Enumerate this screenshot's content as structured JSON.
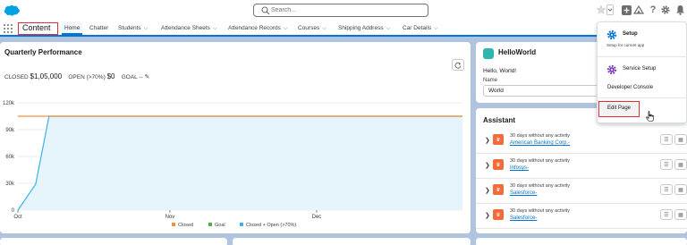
{
  "header": {
    "search": {
      "placeholder": "Search..."
    }
  },
  "nav": {
    "app_name": "Content",
    "tabs": [
      {
        "label": "Home",
        "has_chevron": false,
        "active": true
      },
      {
        "label": "Chatter",
        "has_chevron": false,
        "active": false
      },
      {
        "label": "Students",
        "has_chevron": true,
        "active": false
      },
      {
        "label": "Attendance Sheets",
        "has_chevron": true,
        "active": false
      },
      {
        "label": "Attendance Records",
        "has_chevron": true,
        "active": false
      },
      {
        "label": "Courses",
        "has_chevron": true,
        "active": false
      },
      {
        "label": "Shipping Address",
        "has_chevron": true,
        "active": false
      },
      {
        "label": "Car Details",
        "has_chevron": true,
        "active": false
      }
    ]
  },
  "quarterly": {
    "title": "Quarterly Performance",
    "closed_label": "CLOSED",
    "closed_value": "$1,05,000",
    "open_label": "OPEN (>70%)",
    "open_value": "$0",
    "goal_label": "GOAL",
    "goal_value": "--"
  },
  "chart_data": {
    "type": "area",
    "x_ticks": [
      "Oct",
      "Nov",
      "Dec"
    ],
    "y_ticks": [
      "0",
      "30k",
      "60k",
      "90k",
      "120k"
    ],
    "ylim": [
      0,
      120000
    ],
    "legend": [
      "Closed",
      "Goal",
      "Closed + Open (>70%)"
    ],
    "legend_position": "bottom",
    "grid": true,
    "colors": {
      "closed": "#f0913a",
      "goal": "#4bb04b",
      "closed_open": "#3ab4e8",
      "area_fill": "#e6f5fc"
    },
    "series": [
      {
        "name": "Closed",
        "x_frac": [
          0.0,
          0.04,
          0.07,
          1.0
        ],
        "y": [
          0,
          29000,
          105000,
          105000
        ]
      },
      {
        "name": "Closed + Open (>70%)",
        "x_frac": [
          0.0,
          0.04,
          0.07,
          1.0
        ],
        "y": [
          0,
          29000,
          105000,
          105000
        ]
      }
    ]
  },
  "helloworld": {
    "title": "HelloWorld",
    "greeting": "Hello, World!",
    "name_label": "Name",
    "name_value": "World"
  },
  "assistant": {
    "title": "Assistant",
    "items": [
      {
        "text": "30 days without any activity",
        "link": "American Banking Corp.-"
      },
      {
        "text": "30 days without any activity",
        "link": "Infosys-"
      },
      {
        "text": "30 days without any activity",
        "link": "Salesforce-"
      },
      {
        "text": "30 days without any activity",
        "link": "Salesforce-"
      }
    ]
  },
  "setup_menu": {
    "setup_label": "Setup",
    "setup_sub": "Setup for current app",
    "service_setup_label": "Service Setup",
    "developer_console_label": "Developer Console",
    "edit_page_label": "Edit Page"
  }
}
